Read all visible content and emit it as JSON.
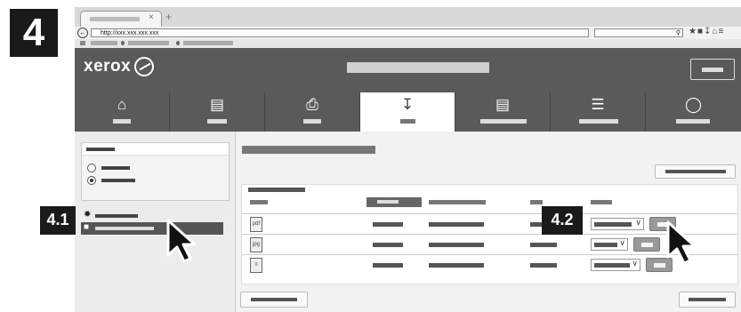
{
  "step": "4",
  "browser": {
    "tab_close": "×",
    "new_tab": "+",
    "back_icon": "back-arrow-icon",
    "url": "http://xxx.xxx.xxx.xxx",
    "search_icon": "magnifier-icon",
    "toolbar_icons": [
      "star-icon",
      "reading-list-icon",
      "download-icon",
      "home-icon",
      "menu-icon"
    ]
  },
  "app": {
    "logo": "xerox"
  },
  "callouts": {
    "select_item": "4.1",
    "print_button": "4.2"
  },
  "colors": {
    "dark": "#5a5a5a",
    "callout": "#1a1a1a",
    "active_tile": "#ffffff"
  }
}
